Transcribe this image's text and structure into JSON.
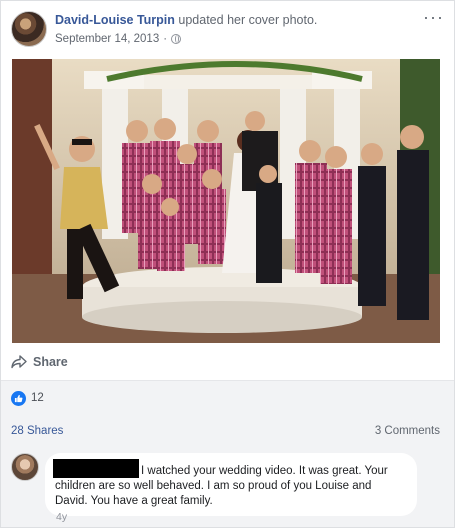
{
  "post": {
    "author": "David-Louise Turpin",
    "action": "updated her cover photo.",
    "date": "September 14, 2013",
    "more_icon": "ellipsis-icon",
    "privacy_icon": "globe-icon"
  },
  "actions": {
    "share_label": "Share",
    "share_icon": "share-arrow-icon"
  },
  "reactions": {
    "like_icon": "thumbs-up-icon",
    "count": "12",
    "accent": "#1877f2"
  },
  "stats": {
    "shares": "28 Shares",
    "comments": "3 Comments"
  },
  "comment": {
    "text": "I watched your wedding video. It was great. Your children are so well behaved. I am so proud of you Louise and David. You have a great family.",
    "time": "4y"
  },
  "colors": {
    "link": "#385898",
    "muted": "#616770",
    "panel": "#f2f3f5"
  }
}
